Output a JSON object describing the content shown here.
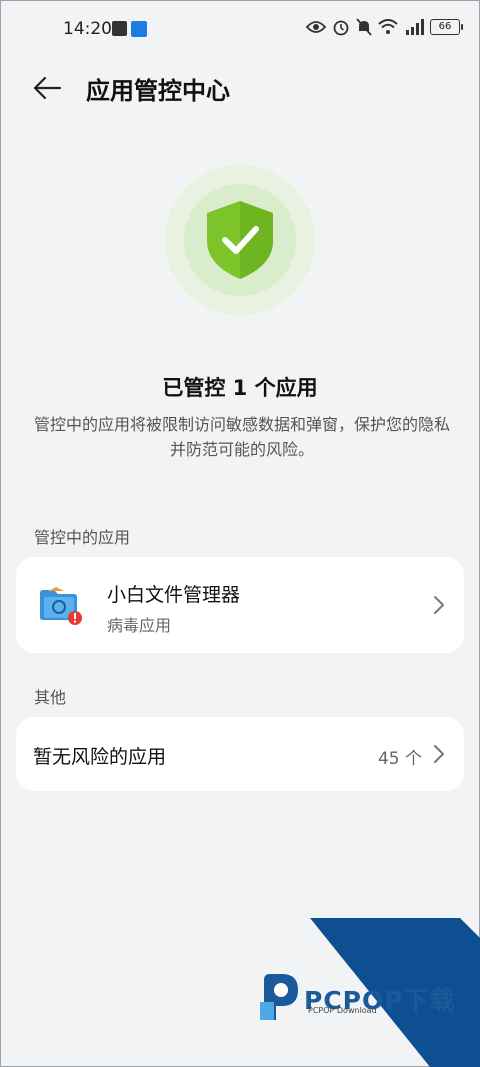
{
  "statusbar": {
    "time": "14:20",
    "battery": "66",
    "icons": [
      "eye-icon",
      "alarm-icon",
      "mute-bell-icon",
      "wifi-icon",
      "signal-5g-icon",
      "battery-icon"
    ]
  },
  "header": {
    "back_icon": "arrow-left-icon",
    "title": "应用管控中心"
  },
  "summary": {
    "title": "已管控 1 个应用",
    "description": "管控中的应用将被限制访问敏感数据和弹窗，保护您的隐私并防范可能的风险。"
  },
  "controlled_section": {
    "label": "管控中的应用",
    "apps": [
      {
        "name": "小白文件管理器",
        "category": "病毒应用",
        "icon": "folder-warning-icon"
      }
    ]
  },
  "other_section": {
    "label": "其他",
    "item_label": "暂无风险的应用",
    "count": "45 个"
  },
  "watermark": {
    "brand": "PCPOP下载",
    "sub": "PCPOP Download"
  },
  "colors": {
    "background": "#f1f3f5",
    "shield_green": "#7cc42a",
    "watermark_blue": "#0d4f91"
  }
}
